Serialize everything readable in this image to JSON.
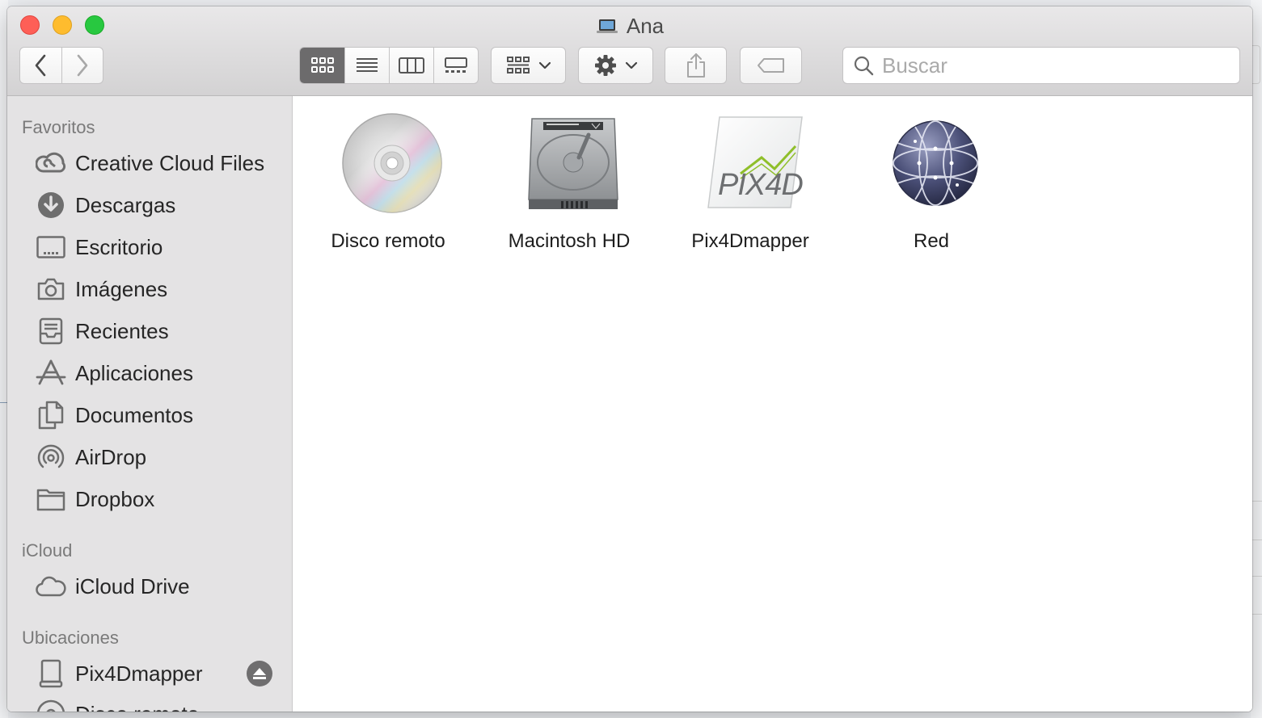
{
  "window": {
    "title": "Ana"
  },
  "toolbar": {
    "search_placeholder": "Buscar"
  },
  "sidebar": {
    "favorites_header": "Favoritos",
    "favorites": [
      {
        "label": "Creative Cloud Files",
        "icon": "creative-cloud-icon"
      },
      {
        "label": "Descargas",
        "icon": "downloads-icon"
      },
      {
        "label": "Escritorio",
        "icon": "desktop-icon"
      },
      {
        "label": "Imágenes",
        "icon": "camera-icon"
      },
      {
        "label": "Recientes",
        "icon": "recents-icon"
      },
      {
        "label": "Aplicaciones",
        "icon": "applications-icon"
      },
      {
        "label": "Documentos",
        "icon": "documents-icon"
      },
      {
        "label": "AirDrop",
        "icon": "airdrop-icon"
      },
      {
        "label": "Dropbox",
        "icon": "folder-icon"
      }
    ],
    "icloud_header": "iCloud",
    "icloud": [
      {
        "label": "iCloud Drive",
        "icon": "cloud-icon"
      }
    ],
    "locations_header": "Ubicaciones",
    "locations": [
      {
        "label": "Pix4Dmapper",
        "icon": "drive-icon"
      },
      {
        "label": "Disco remoto",
        "icon": "disc-icon"
      }
    ]
  },
  "content": {
    "items": [
      {
        "label": "Disco remoto",
        "icon": "cd-disc-icon"
      },
      {
        "label": "Macintosh HD",
        "icon": "hard-drive-icon"
      },
      {
        "label": "Pix4Dmapper",
        "icon": "pix4d-volume-icon"
      },
      {
        "label": "Red",
        "icon": "network-globe-icon"
      }
    ],
    "pix4d_logo_text": "PIX4D"
  }
}
